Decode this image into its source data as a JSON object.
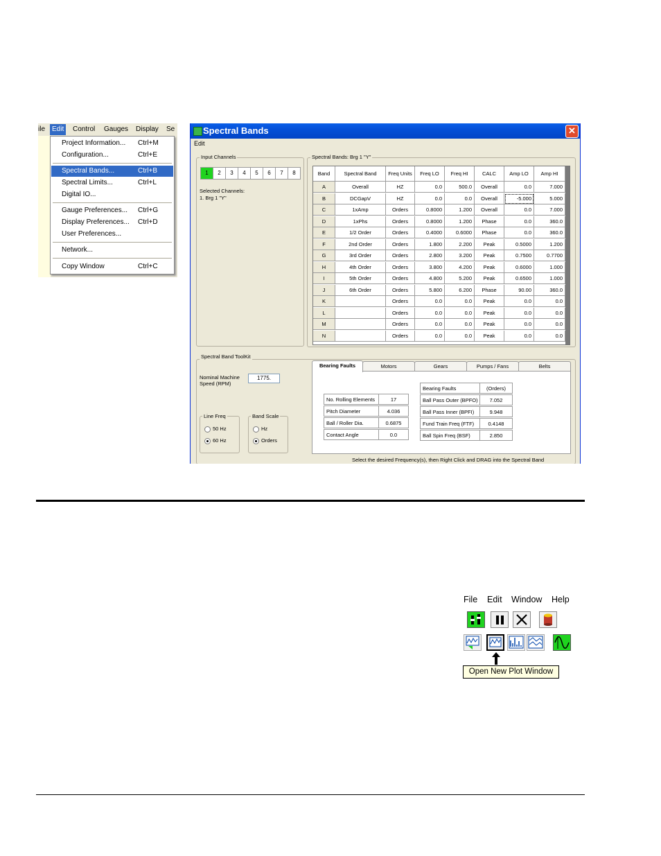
{
  "edit_menu": {
    "menubar": [
      "ile",
      "Edit",
      "Control",
      "Gauges",
      "Display",
      "Se"
    ],
    "items": [
      {
        "label": "Project Information...",
        "shortcut": "Ctrl+M"
      },
      {
        "label": "Configuration...",
        "shortcut": "Ctrl+E"
      },
      {
        "label": "Spectral Bands...",
        "shortcut": "Ctrl+B",
        "selected": true
      },
      {
        "label": "Spectral Limits...",
        "shortcut": "Ctrl+L"
      },
      {
        "label": "Digital IO...",
        "shortcut": ""
      },
      {
        "label": "Gauge Preferences...",
        "shortcut": "Ctrl+G"
      },
      {
        "label": "Display Preferences...",
        "shortcut": "Ctrl+D"
      },
      {
        "label": "User Preferences...",
        "shortcut": ""
      },
      {
        "label": "Network...",
        "shortcut": ""
      },
      {
        "label": "Copy Window",
        "shortcut": "Ctrl+C"
      }
    ]
  },
  "window": {
    "title": "Spectral Bands",
    "close": "✕",
    "menu": "Edit",
    "input_channels": {
      "title": "Input Channels",
      "channels": [
        "1",
        "2",
        "3",
        "4",
        "5",
        "6",
        "7",
        "8"
      ],
      "active": 0,
      "selected_label": "Selected Channels:",
      "selected_value": "1.  Brg 1 \"Y\""
    },
    "bands": {
      "title": "Spectral Bands:  Brg 1 \"Y\"",
      "columns": [
        "Band",
        "Spectral Band",
        "Freq Units",
        "Freq LO",
        "Freq HI",
        "CALC",
        "Amp LO",
        "Amp HI"
      ],
      "rows": [
        [
          "A",
          "Overall",
          "HZ",
          "0.0",
          "500.0",
          "Overall",
          "0.0",
          "7.000"
        ],
        [
          "B",
          "DCGapV",
          "HZ",
          "0.0",
          "0.0",
          "Overall",
          "-5.000",
          "5.000"
        ],
        [
          "C",
          "1xAmp",
          "Orders",
          "0.8000",
          "1.200",
          "Overall",
          "0.0",
          "7.000"
        ],
        [
          "D",
          "1xPhs",
          "Orders",
          "0.8000",
          "1.200",
          "Phase",
          "0.0",
          "360.0"
        ],
        [
          "E",
          "1/2 Order",
          "Orders",
          "0.4000",
          "0.6000",
          "Phase",
          "0.0",
          "360.0"
        ],
        [
          "F",
          "2nd Order",
          "Orders",
          "1.800",
          "2.200",
          "Peak",
          "0.5000",
          "1.200"
        ],
        [
          "G",
          "3rd Order",
          "Orders",
          "2.800",
          "3.200",
          "Peak",
          "0.7500",
          "0.7700"
        ],
        [
          "H",
          "4th Order",
          "Orders",
          "3.800",
          "4.200",
          "Peak",
          "0.6000",
          "1.000"
        ],
        [
          "I",
          "5th Order",
          "Orders",
          "4.800",
          "5.200",
          "Peak",
          "0.6500",
          "1.000"
        ],
        [
          "J",
          "6th Order",
          "Orders",
          "5.800",
          "6.200",
          "Phase",
          "90.00",
          "360.0"
        ],
        [
          "K",
          "",
          "Orders",
          "0.0",
          "0.0",
          "Peak",
          "0.0",
          "0.0"
        ],
        [
          "L",
          "",
          "Orders",
          "0.0",
          "0.0",
          "Peak",
          "0.0",
          "0.0"
        ],
        [
          "M",
          "",
          "Orders",
          "0.0",
          "0.0",
          "Peak",
          "0.0",
          "0.0"
        ],
        [
          "N",
          "",
          "Orders",
          "0.0",
          "0.0",
          "Peak",
          "0.0",
          "0.0"
        ]
      ]
    },
    "toolkit": {
      "title": "Spectral Band ToolKit",
      "speed_label_1": "Nominal Machine",
      "speed_label_2": "Speed (RPM)",
      "speed_value": "1775.",
      "line_freq": {
        "title": "Line Freq",
        "options": [
          "50 Hz",
          "60 Hz"
        ],
        "selected": 1
      },
      "band_scale": {
        "title": "Band Scale",
        "options": [
          "Hz",
          "Orders"
        ],
        "selected": 1
      },
      "tabs": [
        "Bearing Faults",
        "Motors",
        "Gears",
        "Pumps / Fans",
        "Belts"
      ],
      "active_tab": 0,
      "params": [
        {
          "label": "No. Rolling Elements",
          "value": "17"
        },
        {
          "label": "Pitch Diameter",
          "value": "4.036"
        },
        {
          "label": "Ball / Roller Dia.",
          "value": "0.6875"
        },
        {
          "label": "Contact Angle",
          "value": "0.0"
        }
      ],
      "faults_header": [
        "Bearing Faults",
        "(Orders)"
      ],
      "faults": [
        {
          "label": "Ball Pass Outer (BPFO)",
          "value": "7.052"
        },
        {
          "label": "Ball Pass Inner (BPFI)",
          "value": "9.948"
        },
        {
          "label": "Fund Train Freq (FTF)",
          "value": "0.4148"
        },
        {
          "label": "Ball Spin Freq (BSF)",
          "value": "2.850"
        }
      ],
      "hint": "Select the desired Frequency(s), then Right Click and DRAG into the Spectral Band"
    }
  },
  "toolbar": {
    "menu": [
      "File",
      "Edit",
      "Window",
      "Help"
    ],
    "tooltip": "Open New Plot Window"
  },
  "colors": {
    "accent": "#316ac5",
    "active_channel": "#1fd31f",
    "titlebar": "#0550d7"
  }
}
